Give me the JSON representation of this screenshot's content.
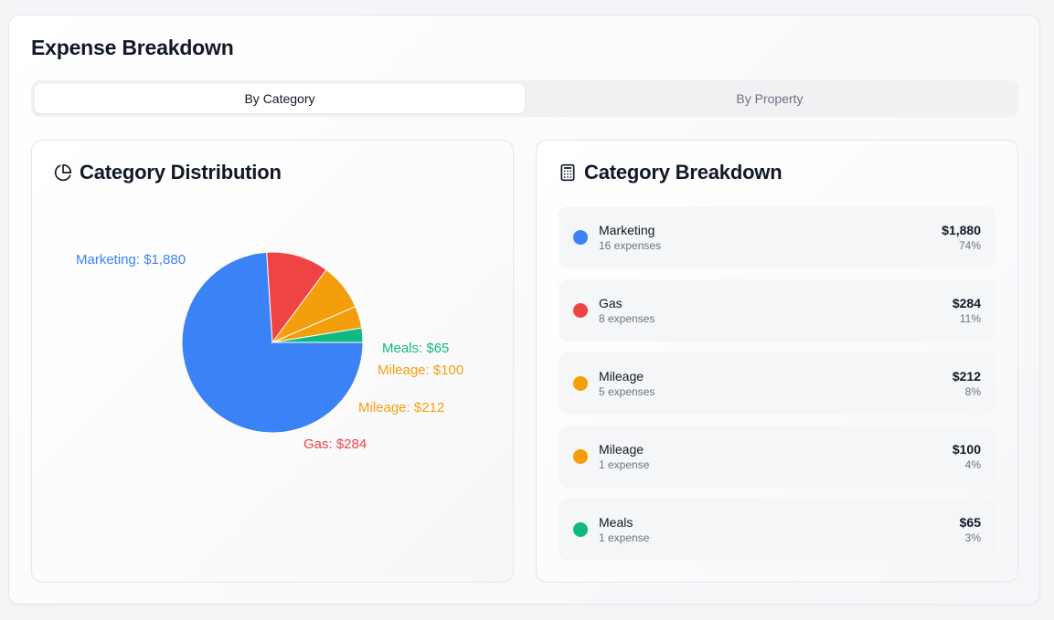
{
  "page_title": "Expense Breakdown",
  "tabs": [
    {
      "label": "By Category",
      "active": true
    },
    {
      "label": "By Property",
      "active": false
    }
  ],
  "distribution": {
    "title": "Category Distribution",
    "icon": "pie-chart-icon"
  },
  "breakdown": {
    "title": "Category Breakdown",
    "icon": "calculator-icon",
    "items": [
      {
        "name": "Marketing",
        "count": "16 expenses",
        "amount": "$1,880",
        "percent": "74%",
        "color": "#3b82f6"
      },
      {
        "name": "Gas",
        "count": "8 expenses",
        "amount": "$284",
        "percent": "11%",
        "color": "#ef4444"
      },
      {
        "name": "Mileage",
        "count": "5 expenses",
        "amount": "$212",
        "percent": "8%",
        "color": "#f59e0b"
      },
      {
        "name": "Mileage",
        "count": "1 expense",
        "amount": "$100",
        "percent": "4%",
        "color": "#f59e0b"
      },
      {
        "name": "Meals",
        "count": "1 expense",
        "amount": "$65",
        "percent": "3%",
        "color": "#10b981"
      }
    ]
  },
  "chart_data": {
    "type": "pie",
    "slices": [
      {
        "label": "Marketing: $1,880",
        "value": 1880,
        "color": "#3b82f6"
      },
      {
        "label": "Gas: $284",
        "value": 284,
        "color": "#ef4444"
      },
      {
        "label": "Mileage: $212",
        "value": 212,
        "color": "#f59e0b"
      },
      {
        "label": "Mileage: $100",
        "value": 100,
        "color": "#f59e0b"
      },
      {
        "label": "Meals: $65",
        "value": 65,
        "color": "#10b981"
      }
    ]
  }
}
